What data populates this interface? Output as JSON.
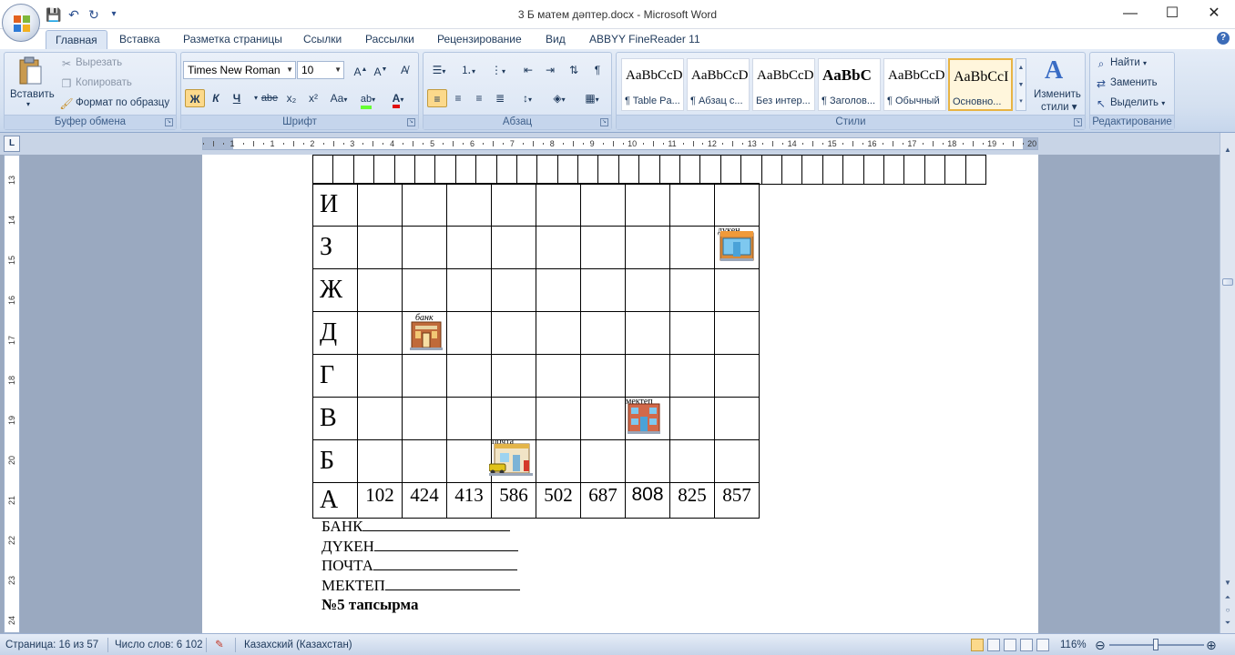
{
  "window": {
    "title": "3 Б матем дәптер.docx - Microsoft Word",
    "minimize": "—",
    "maximize": "☐",
    "close": "✕"
  },
  "qat": {
    "save_icon": "save-icon",
    "undo_icon": "undo-icon",
    "redo_icon": "redo-icon",
    "customize_icon": "customize-icon"
  },
  "tabs": [
    {
      "label": "Главная",
      "active": true
    },
    {
      "label": "Вставка"
    },
    {
      "label": "Разметка страницы"
    },
    {
      "label": "Ссылки"
    },
    {
      "label": "Рассылки"
    },
    {
      "label": "Рецензирование"
    },
    {
      "label": "Вид"
    },
    {
      "label": "ABBYY FineReader 11"
    }
  ],
  "ribbon": {
    "clipboard": {
      "label": "Буфер обмена",
      "paste": "Вставить",
      "cut": "Вырезать",
      "copy": "Копировать",
      "format_painter": "Формат по образцу"
    },
    "font": {
      "label": "Шрифт",
      "font_name": "Times New Roman",
      "font_size": "10",
      "bold": "Ж",
      "italic": "К",
      "underline": "Ч",
      "strike": "abe",
      "subscript": "x₂",
      "superscript": "x²",
      "change_case": "Aa"
    },
    "paragraph": {
      "label": "Абзац"
    },
    "styles": {
      "label": "Стили",
      "items": [
        {
          "preview": "AaBbCcDd",
          "name": "¶ Table Pa..."
        },
        {
          "preview": "AaBbCcDd",
          "name": "¶ Абзац с..."
        },
        {
          "preview": "AaBbCcDd",
          "name": "Без интер..."
        },
        {
          "preview": "AaBbC",
          "name": "¶ Заголов..."
        },
        {
          "preview": "AaBbCcDd",
          "name": "¶ Обычный"
        },
        {
          "preview": "AaBbCcI",
          "name": "Основно...",
          "selected": true
        }
      ],
      "change_styles_1": "Изменить",
      "change_styles_2": "стили ▾"
    },
    "editing": {
      "label": "Редактирование",
      "find": "Найти",
      "replace": "Заменить",
      "select": "Выделить"
    }
  },
  "ruler": {
    "tab_selector": "L",
    "h_numbers": [
      "1",
      "1",
      "2",
      "3",
      "4",
      "5",
      "6",
      "7",
      "8",
      "9",
      "10",
      "11",
      "12",
      "13",
      "14",
      "15",
      "16",
      "17",
      "18",
      "19",
      "20"
    ],
    "v_numbers": [
      "13",
      "14",
      "15",
      "16",
      "17",
      "18",
      "19",
      "20",
      "21",
      "22",
      "23",
      "24"
    ]
  },
  "document": {
    "rows": [
      {
        "letter": "И"
      },
      {
        "letter": "З"
      },
      {
        "letter": "Ж"
      },
      {
        "letter": "Д"
      },
      {
        "letter": "Г"
      },
      {
        "letter": "В"
      },
      {
        "letter": "Б"
      }
    ],
    "bottom_row": {
      "letter": "А",
      "numbers": [
        "102",
        "424",
        "413",
        "586",
        "502",
        "687",
        "808",
        "825",
        "857"
      ]
    },
    "buildings": {
      "dukan": "дүкен",
      "bank": "банк",
      "mektep": "мектеп",
      "pochta": "почта"
    },
    "answers": [
      "БАНК",
      "ДҮКЕН",
      "ПОЧТА",
      "МЕКТЕП"
    ],
    "task": "№5 тапсырма"
  },
  "status": {
    "page": "Страница: 16 из 57",
    "words": "Число слов: 6 102",
    "language": "Казахский (Казахстан)",
    "zoom": "116%"
  },
  "colors": {
    "ribbon_bg": "#dae5f4",
    "accent": "#2b579a",
    "selected_style": "#e8b444"
  }
}
